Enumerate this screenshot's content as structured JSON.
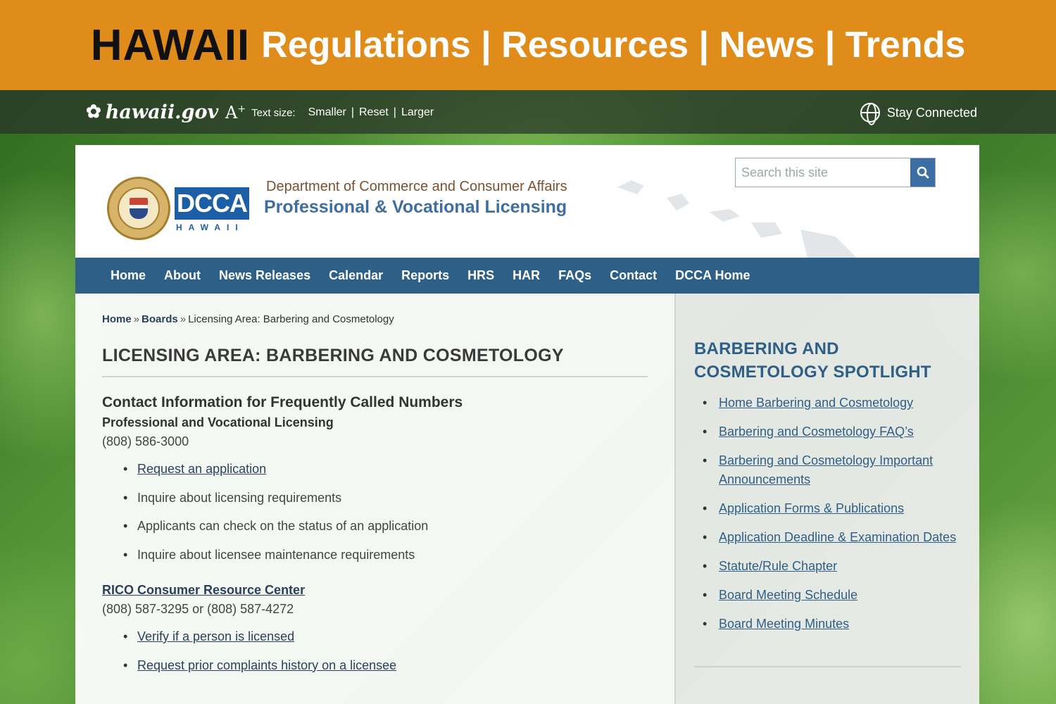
{
  "banner": {
    "state": "HAWAII",
    "topics": "Regulations | Resources | News | Trends"
  },
  "govbar": {
    "logo_text": "hawaii.gov",
    "text_size_label": "Text size:",
    "smaller": "Smaller",
    "reset": "Reset",
    "larger": "Larger",
    "sep": "|",
    "stay_connected": "Stay Connected"
  },
  "header": {
    "dcca_logo": "DCCA",
    "dcca_sub": "HAWAII",
    "department": "Department of Commerce and Consumer Affairs",
    "division": "Professional & Vocational Licensing",
    "search_placeholder": "Search this site"
  },
  "nav": [
    {
      "label": "Home"
    },
    {
      "label": "About"
    },
    {
      "label": "News Releases"
    },
    {
      "label": "Calendar"
    },
    {
      "label": "Reports"
    },
    {
      "label": "HRS"
    },
    {
      "label": "HAR"
    },
    {
      "label": "FAQs"
    },
    {
      "label": "Contact"
    },
    {
      "label": "DCCA Home"
    }
  ],
  "breadcrumb": {
    "home": "Home",
    "boards": "Boards",
    "current": "Licensing Area: Barbering and Cosmetology",
    "sep": "»"
  },
  "main": {
    "title": "LICENSING AREA: BARBERING AND COSMETOLOGY",
    "contact_heading": "Contact Information for Frequently Called Numbers",
    "pvl_heading": "Professional and Vocational Licensing",
    "pvl_phone": "(808) 586-3000",
    "pvl_items": [
      {
        "text": "Request an application",
        "link": true
      },
      {
        "text": "Inquire about licensing requirements",
        "link": false
      },
      {
        "text": "Applicants can check on the status of an application",
        "link": false
      },
      {
        "text": "Inquire about licensee maintenance requirements",
        "link": false
      }
    ],
    "rico_heading": "RICO Consumer Resource Center",
    "rico_phone": "(808) 587-3295 or (808) 587-4272",
    "rico_items": [
      {
        "text": "Verify if a person is licensed",
        "link": true
      },
      {
        "text": "Request prior complaints history on a licensee",
        "link": true
      }
    ]
  },
  "sidebar": {
    "heading": "BARBERING AND COSMETOLOGY SPOTLIGHT",
    "links": [
      {
        "label": "Home Barbering and Cosmetology"
      },
      {
        "label": "Barbering and Cosmetology FAQ’s"
      },
      {
        "label": "Barbering and Cosmetology Important Announcements"
      },
      {
        "label": "Application Forms & Publications"
      },
      {
        "label": "Application Deadline & Examination Dates"
      },
      {
        "label": "Statute/Rule Chapter"
      },
      {
        "label": "Board Meeting Schedule"
      },
      {
        "label": "Board Meeting Minutes"
      }
    ]
  },
  "icons": {
    "flower": "hibiscus-icon",
    "text_size": "text-size-icon",
    "globe": "globe-icon",
    "search": "search-icon"
  },
  "colors": {
    "banner": "#e08c1a",
    "nav": "#2e5f87",
    "link": "#2b3f5c",
    "sidebar_heading": "#2f5f86"
  }
}
